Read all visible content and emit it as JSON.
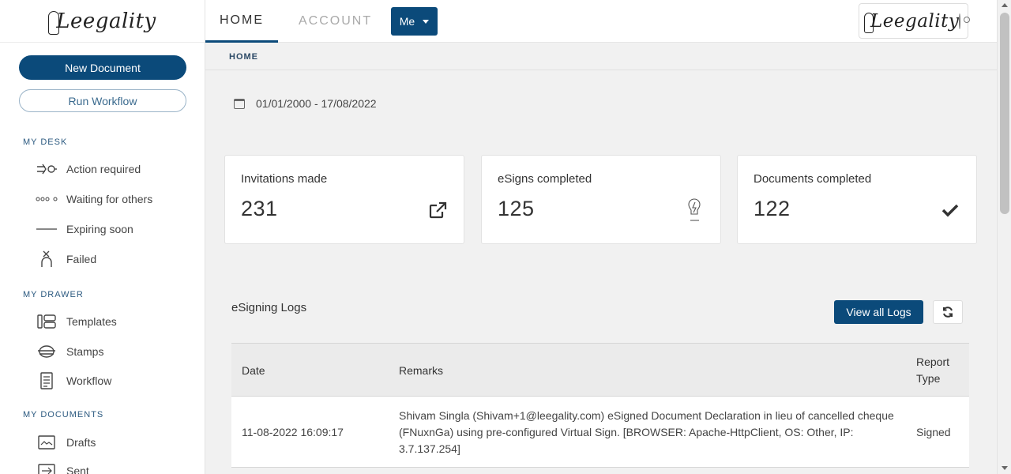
{
  "brand": {
    "name": "Leegality"
  },
  "sidebar": {
    "new_document": "New Document",
    "run_workflow": "Run Workflow",
    "sections": [
      {
        "title": "MY DESK",
        "items": [
          "Action required",
          "Waiting for others",
          "Expiring soon",
          "Failed"
        ]
      },
      {
        "title": "MY DRAWER",
        "items": [
          "Templates",
          "Stamps",
          "Workflow"
        ]
      },
      {
        "title": "MY DOCUMENTS",
        "items": [
          "Drafts",
          "Sent"
        ]
      }
    ]
  },
  "header": {
    "tabs": [
      "HOME",
      "ACCOUNT"
    ],
    "active_tab": "HOME",
    "user_menu": "Me"
  },
  "breadcrumb": "HOME",
  "date_range": "01/01/2000 - 17/08/2022",
  "stats": [
    {
      "label": "Invitations made",
      "value": "231",
      "icon": "external-link-icon"
    },
    {
      "label": "eSigns completed",
      "value": "125",
      "icon": "esign-pen-icon"
    },
    {
      "label": "Documents completed",
      "value": "122",
      "icon": "checkmark-icon"
    }
  ],
  "logs": {
    "title": "eSigning Logs",
    "view_all": "View all Logs",
    "columns": [
      "Date",
      "Remarks",
      "Report Type"
    ],
    "rows": [
      {
        "date": "11-08-2022 16:09:17",
        "remarks": "Shivam Singla (Shivam+1@leegality.com) eSigned Document Declaration in lieu of cancelled cheque (FNuxnGa) using pre-configured Virtual Sign. [BROWSER: Apache-HttpClient, OS: Other, IP: 3.7.137.254]",
        "report_type": "Signed"
      }
    ]
  },
  "colors": {
    "primary": "#0b4a7a",
    "section_title": "#2c5a80"
  }
}
